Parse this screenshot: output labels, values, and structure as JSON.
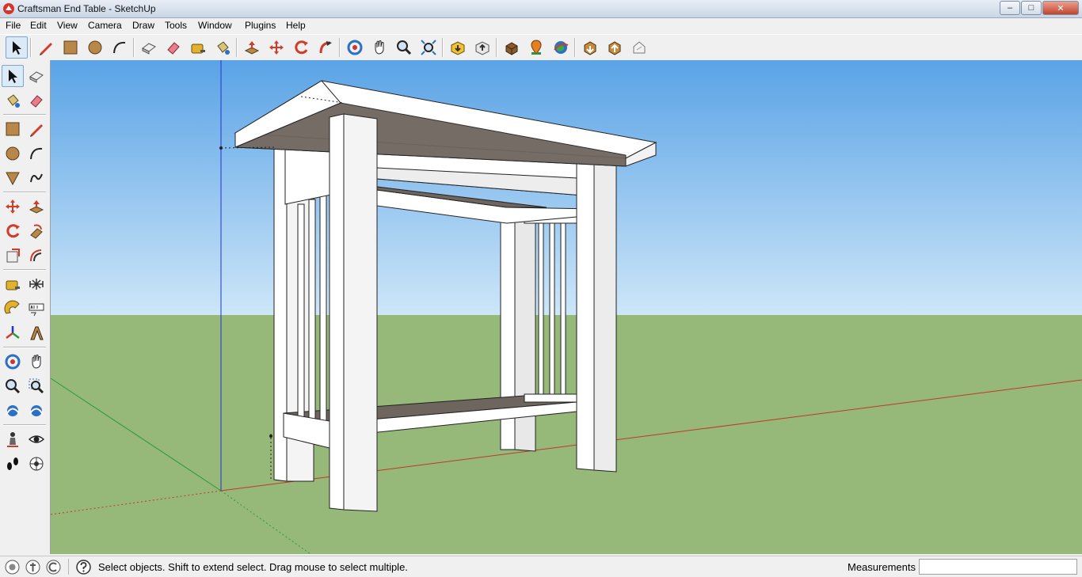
{
  "window": {
    "title": "Craftsman End Table - SketchUp",
    "minimize_glyph": "–",
    "maximize_glyph": "□",
    "close_glyph": "✕"
  },
  "menu": [
    {
      "label": "File"
    },
    {
      "label": "Edit"
    },
    {
      "label": "View"
    },
    {
      "label": "Camera"
    },
    {
      "label": "Draw"
    },
    {
      "label": "Tools"
    },
    {
      "label": "Window"
    },
    {
      "label": "Plugins"
    },
    {
      "label": "Help"
    }
  ],
  "toolbar_icons": [
    "select-icon",
    "pencil-line-icon",
    "rectangle-icon",
    "circle-icon",
    "arc-icon",
    "make-component-icon",
    "eraser-icon",
    "tape-measure-icon",
    "paint-bucket-icon",
    "push-pull-icon",
    "move-icon",
    "rotate-icon",
    "follow-me-icon",
    "orbit-icon",
    "pan-icon",
    "zoom-icon",
    "zoom-extents-icon",
    "get-models-icon",
    "share-model-icon",
    "component-icon",
    "add-location-icon",
    "google-earth-icon",
    "get-photo-texture-icon",
    "extension-warehouse-icon",
    "layout-icon"
  ],
  "left_toolbar_icons": [
    "select-icon",
    "make-component-icon",
    "paint-bucket-icon",
    "eraser-icon",
    "rectangle-icon",
    "line-icon",
    "circle-icon",
    "arc-icon",
    "polygon-icon",
    "freehand-icon",
    "move-icon",
    "push-pull-icon",
    "rotate-icon",
    "follow-me-icon",
    "scale-icon",
    "offset-icon",
    "tape-measure-icon",
    "dimension-icon",
    "protractor-icon",
    "text-icon",
    "axes-icon",
    "3d-text-icon",
    "orbit-icon",
    "pan-icon",
    "zoom-icon",
    "zoom-window-icon",
    "previous-view-icon",
    "next-view-icon",
    "position-camera-icon",
    "look-around-icon",
    "walk-icon",
    "section-plane-icon"
  ],
  "status": {
    "text": "Select objects. Shift to extend select. Drag mouse to select multiple.",
    "measurements_label": "Measurements",
    "measurements_value": ""
  },
  "colors": {
    "sky_top": "#5aa3e6",
    "sky_bottom": "#cde6f8",
    "ground": "#96b878",
    "table_white": "#ffffff",
    "table_shadow": "#d9d9d9",
    "shelf_top": "#6e655e",
    "axis_red": "#c0392b",
    "axis_green": "#2e9a3a",
    "axis_blue": "#2233cc"
  }
}
